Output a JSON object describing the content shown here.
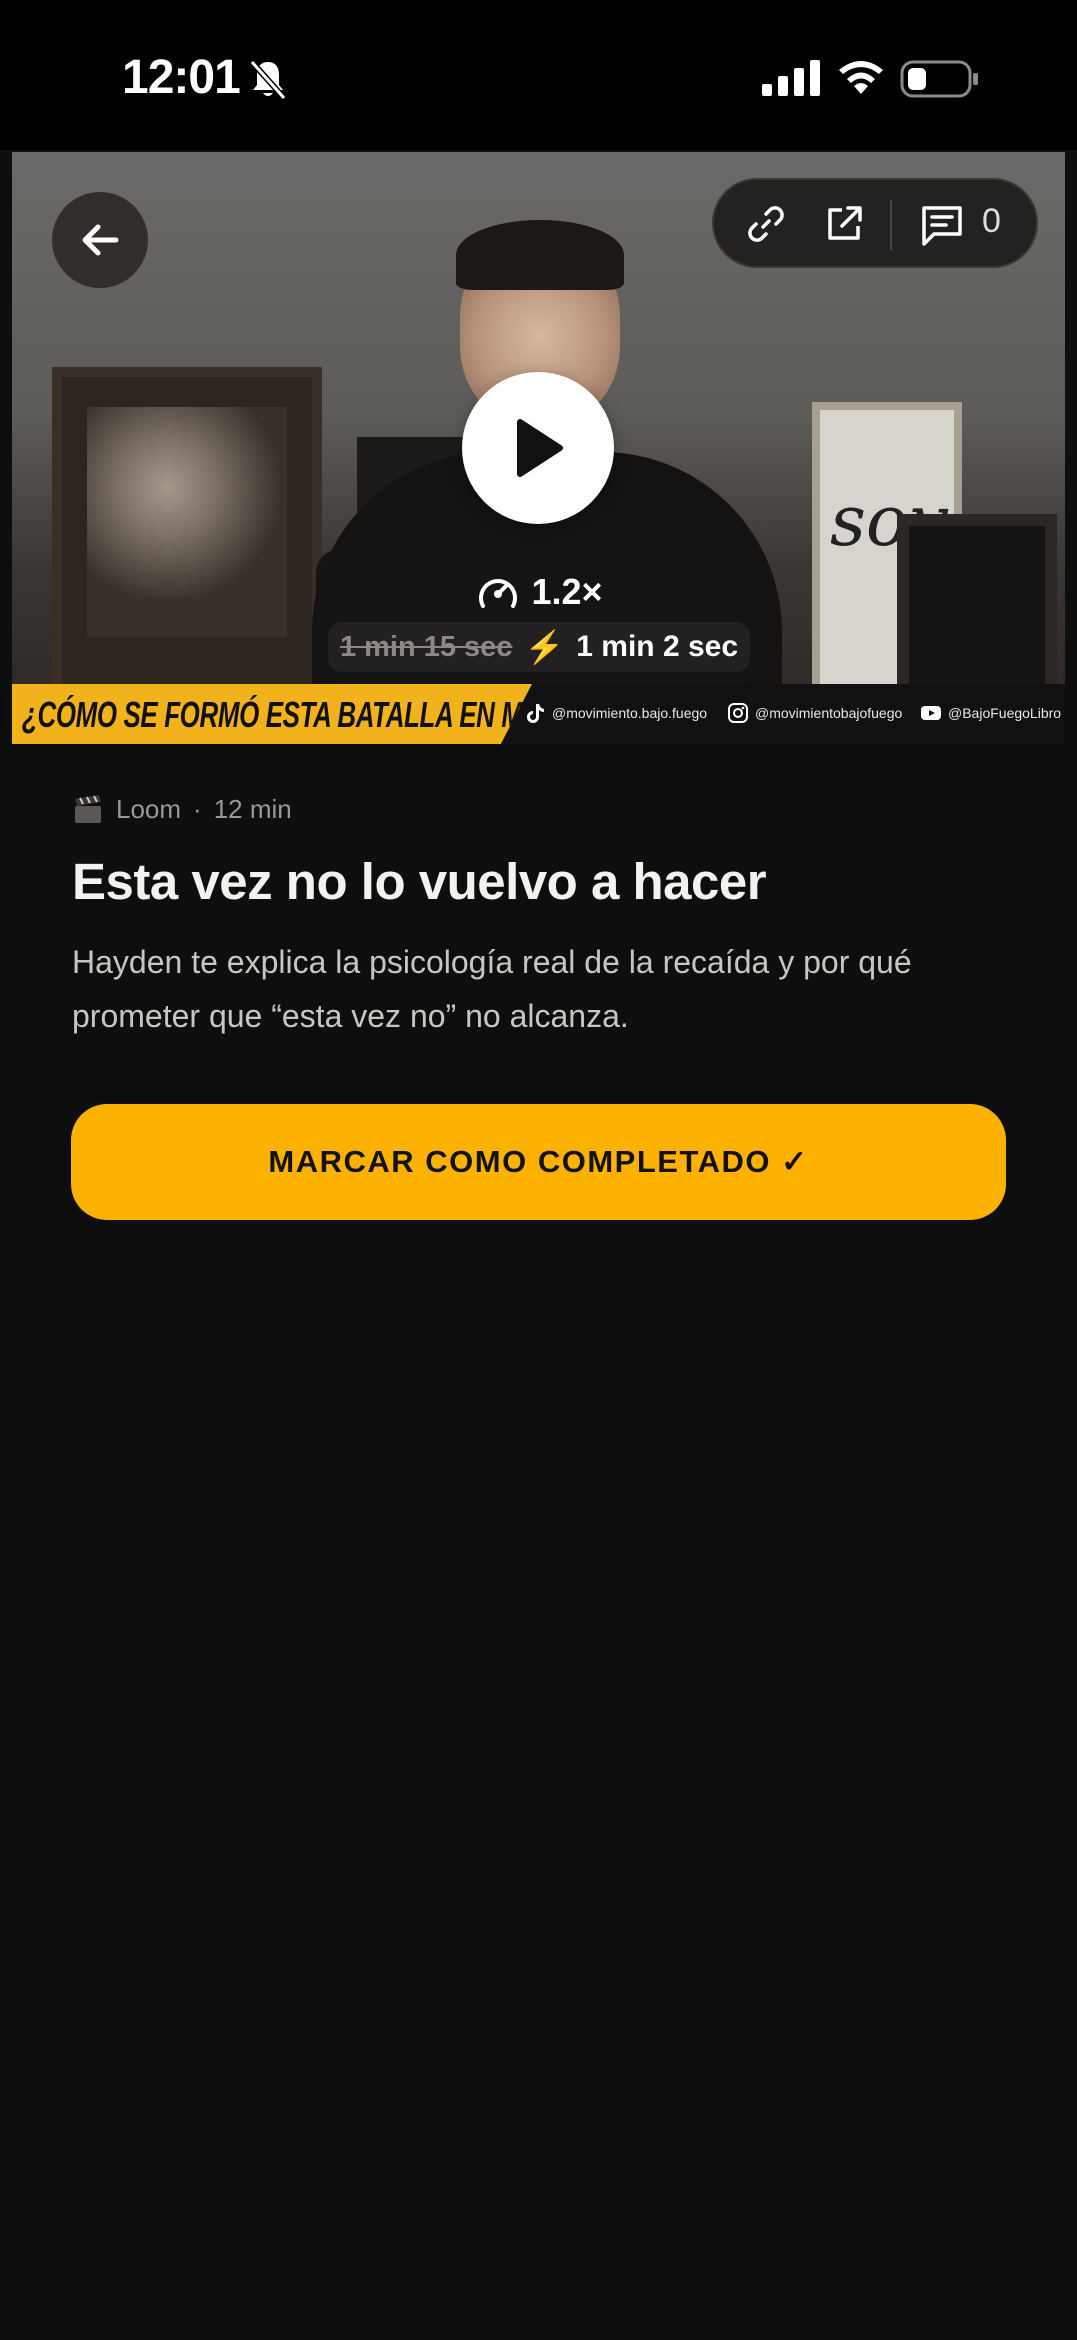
{
  "status_bar": {
    "time": "12:01"
  },
  "video": {
    "speed": "1.2×",
    "original_duration": "1 min 15 sec",
    "boosted_duration": "1 min 2 sec",
    "comment_count": "0",
    "banner_title": "¿CÓMO SE FORMÓ ESTA BATALLA EN MÍ?",
    "socials": {
      "tiktok": "@movimiento.bajo.fuego",
      "instagram": "@movimientobajofuego",
      "youtube": "@BajoFuegoLibro"
    }
  },
  "lesson": {
    "source": "Loom",
    "separator": "·",
    "duration": "12 min",
    "title": "Esta vez no lo vuelvo a hacer",
    "description": "Hayden te explica la psicología real de la recaída y por qué prometer que “esta vez no” no alcanza.",
    "cta_label": "MARCAR COMO COMPLETADO ✓"
  },
  "colors": {
    "accent": "#FDB202",
    "background": "#0E0E0E",
    "banner_yellow": "#F2B21C"
  },
  "icons": [
    "bell-slash-icon",
    "signal-icon",
    "wifi-icon",
    "battery-icon",
    "back-arrow-icon",
    "link-icon",
    "share-icon",
    "comment-icon",
    "play-icon",
    "speed-icon",
    "bolt-icon",
    "tiktok-icon",
    "instagram-icon",
    "youtube-icon",
    "clapperboard-icon"
  ]
}
